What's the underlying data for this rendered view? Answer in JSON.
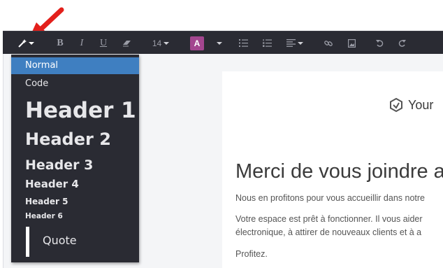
{
  "toolbar": {
    "buttons": [
      {
        "name": "style",
        "icon": "magic-wand-icon"
      },
      {
        "name": "bold",
        "label": "B"
      },
      {
        "name": "italic",
        "label": "I"
      },
      {
        "name": "underline",
        "label": "U"
      },
      {
        "name": "eraser",
        "icon": "eraser-icon"
      },
      {
        "name": "font-size",
        "value": "14"
      },
      {
        "name": "text-color",
        "label": "A",
        "color": "#a3468f"
      },
      {
        "name": "unordered-list",
        "icon": "list-ul-icon"
      },
      {
        "name": "ordered-list",
        "icon": "list-ol-icon"
      },
      {
        "name": "align",
        "icon": "align-left-icon"
      },
      {
        "name": "link",
        "icon": "link-icon"
      },
      {
        "name": "image",
        "icon": "image-icon"
      },
      {
        "name": "undo",
        "icon": "undo-icon"
      },
      {
        "name": "redo",
        "icon": "redo-icon"
      }
    ]
  },
  "dropdown": {
    "selected": "Normal",
    "items": [
      "Normal",
      "Code",
      "Header 1",
      "Header 2",
      "Header 3",
      "Header 4",
      "Header 5",
      "Header 6",
      "Quote"
    ]
  },
  "card": {
    "logo_text": "Your",
    "title": "Merci de vous joindre a",
    "p1": "Nous en profitons pour vous accueillir dans notre",
    "p2": "Votre espace est prêt à fonctionner. Il vous aider",
    "p3": "électronique, à attirer de nouveaux clients et à a",
    "p4": "Profitez."
  },
  "colors": {
    "toolbar_bg": "#2a2b33",
    "dropdown_selected": "#3f7fc1",
    "accent": "#a3468f",
    "annotation_arrow": "#e3201b"
  }
}
